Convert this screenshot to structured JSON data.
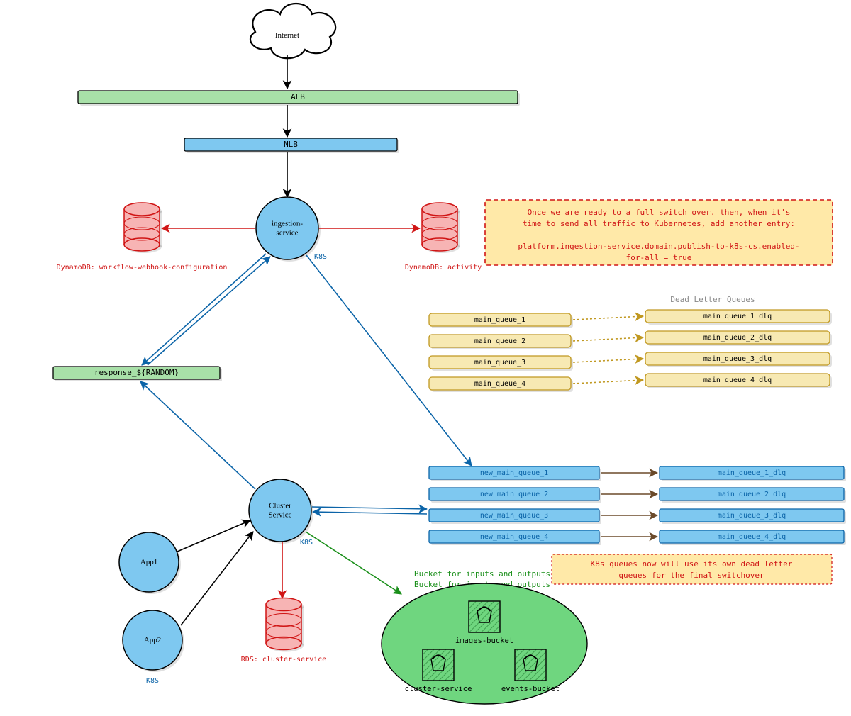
{
  "nodes": {
    "internet": "Internet",
    "alb": "ALB",
    "nlb": "NLB",
    "ingestion": {
      "title": "ingestion-\nservice",
      "tag": "K8S"
    },
    "dynamodb_left": "DynamoDB: workflow-webhook-configuration",
    "dynamodb_right": "DynamoDB: activity",
    "response_queue": "response_${RANDOM}",
    "cluster_service": {
      "title": "Cluster\nService",
      "tag": "K8S"
    },
    "app1": "App1",
    "app2": "App2",
    "k8s_label": "K8S",
    "rds": "RDS: cluster-service",
    "bucket_hdr1": "Bucket for inputs and outputs",
    "bucket_hdr2": "Bucket for inputs and outputs",
    "bucket_images": "images-bucket",
    "bucket_cluster": "cluster-service",
    "bucket_events": "events-bucket"
  },
  "notes": {
    "switchover_line1": "Once we are ready to a full switch over. then, when it's",
    "switchover_line2": "time to send all traffic to Kubernetes, add another entry:",
    "switchover_line3": "platform.ingestion-service.domain.publish-to-k8s-cs.enabled-",
    "switchover_line4": "for-all = true",
    "dlq_header": "Dead Letter Queues",
    "k8s_note_line1": "K8s queues now will use its own dead letter",
    "k8s_note_line2": "queues for the final switchover"
  },
  "old_queues": {
    "main": [
      "main_queue_1",
      "main_queue_2",
      "main_queue_3",
      "main_queue_4"
    ],
    "dlq": [
      "main_queue_1_dlq",
      "main_queue_2_dlq",
      "main_queue_3_dlq",
      "main_queue_4_dlq"
    ]
  },
  "new_queues": {
    "main": [
      "new_main_queue_1",
      "new_main_queue_2",
      "new_main_queue_3",
      "new_main_queue_4"
    ],
    "dlq": [
      "main_queue_1_dlq",
      "main_queue_2_dlq",
      "main_queue_3_dlq",
      "main_queue_4_dlq"
    ]
  },
  "colors": {
    "green_fill": "#a8e0a8",
    "green_stroke": "#1a8f1a",
    "blue_fill": "#7ec8f0",
    "blue_stroke": "#0b64a8",
    "cream_fill": "#f7e9b3",
    "cream_stroke": "#c09820",
    "red_stroke": "#d01515",
    "red_fill": "#f7b4b4",
    "note_bg": "#ffe9a8",
    "bucket_bg": "#6fd67f"
  }
}
